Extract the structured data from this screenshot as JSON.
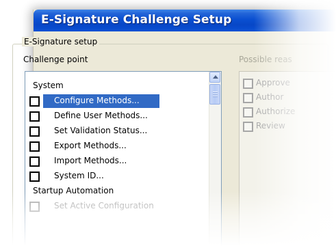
{
  "window": {
    "title": "E-Signature Challenge Setup"
  },
  "group": {
    "legend": "E-Signature setup"
  },
  "challenge": {
    "label": "Challenge point",
    "items": [
      {
        "label": "System",
        "type": "group",
        "checked": false,
        "disabled": false,
        "selected": false
      },
      {
        "label": "Configure Methods...",
        "type": "item",
        "checked": false,
        "disabled": false,
        "selected": true
      },
      {
        "label": "Define User Methods...",
        "type": "item",
        "checked": false,
        "disabled": false,
        "selected": false
      },
      {
        "label": "Set Validation Status...",
        "type": "item",
        "checked": false,
        "disabled": false,
        "selected": false
      },
      {
        "label": "Export Methods...",
        "type": "item",
        "checked": false,
        "disabled": false,
        "selected": false
      },
      {
        "label": "Import Methods...",
        "type": "item",
        "checked": false,
        "disabled": false,
        "selected": false
      },
      {
        "label": "System ID...",
        "type": "item",
        "checked": false,
        "disabled": false,
        "selected": false
      },
      {
        "label": "Startup Automation",
        "type": "group",
        "checked": false,
        "disabled": false,
        "selected": false
      },
      {
        "label": "Set Active Configuration",
        "type": "item",
        "checked": false,
        "disabled": true,
        "selected": false
      }
    ]
  },
  "reasons": {
    "label": "Possible reas",
    "items": [
      {
        "label": "Approve",
        "checked": false
      },
      {
        "label": "Author",
        "checked": false
      },
      {
        "label": "Authorize",
        "checked": false
      },
      {
        "label": "Review",
        "checked": false
      }
    ]
  },
  "colors": {
    "titlebar": "#0a4fd1",
    "selection": "#316ac5",
    "dialog_bg": "#ece9d8"
  }
}
